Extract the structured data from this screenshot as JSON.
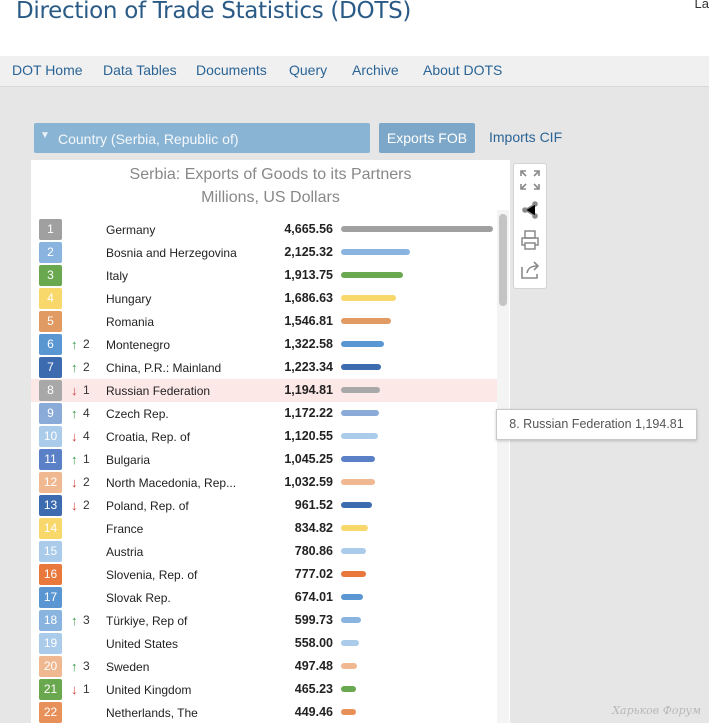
{
  "header": {
    "title": "Direction of Trade Statistics (DOTS)",
    "corner_text": "La"
  },
  "nav": {
    "items": [
      {
        "label": "DOT Home"
      },
      {
        "label": "Data Tables"
      },
      {
        "label": "Documents"
      },
      {
        "label": "Query"
      },
      {
        "label": "Archive"
      },
      {
        "label": "About DOTS"
      }
    ]
  },
  "controls": {
    "country_select": "Country  (Serbia, Republic of)",
    "exports_label": "Exports FOB",
    "imports_label": "Imports CIF"
  },
  "tooltip": {
    "text": "8. Russian Federation 1,194.81"
  },
  "watermark": "Харьков Форум",
  "colors": {
    "highlight_row": "#fde8e8",
    "up_arrow": "#3a9a4a",
    "down_arrow": "#d23c3c",
    "tab_active": "#7ca7c8"
  },
  "chart_data": {
    "type": "bar",
    "orientation": "horizontal",
    "title": "Serbia: Exports of Goods to its Partners",
    "subtitle": "Millions, US Dollars",
    "highlighted_rank": 8,
    "max_value": 4665.56,
    "rows": [
      {
        "rank": "1",
        "dir": "",
        "chg": "",
        "name": "Germany",
        "value": 4665.56,
        "value_label": "4,665.56",
        "color": "#a0a0a0"
      },
      {
        "rank": "2",
        "dir": "",
        "chg": "",
        "name": "Bosnia and Herzegovina",
        "value": 2125.32,
        "value_label": "2,125.32",
        "color": "#8ab4e0"
      },
      {
        "rank": "3",
        "dir": "",
        "chg": "",
        "name": "Italy",
        "value": 1913.75,
        "value_label": "1,913.75",
        "color": "#6aa84f"
      },
      {
        "rank": "4",
        "dir": "",
        "chg": "",
        "name": "Hungary",
        "value": 1686.63,
        "value_label": "1,686.63",
        "color": "#f8d86a"
      },
      {
        "rank": "5",
        "dir": "",
        "chg": "",
        "name": "Romania",
        "value": 1546.81,
        "value_label": "1,546.81",
        "color": "#e09a62"
      },
      {
        "rank": "6",
        "dir": "up",
        "chg": "2",
        "name": "Montenegro",
        "value": 1322.58,
        "value_label": "1,322.58",
        "color": "#5a96d2"
      },
      {
        "rank": "7",
        "dir": "up",
        "chg": "2",
        "name": "China, P.R.: Mainland",
        "value": 1223.34,
        "value_label": "1,223.34",
        "color": "#3d6bb0"
      },
      {
        "rank": "8",
        "dir": "down",
        "chg": "1",
        "name": "Russian Federation",
        "value": 1194.81,
        "value_label": "1,194.81",
        "color": "#a8a8a8"
      },
      {
        "rank": "9",
        "dir": "up",
        "chg": "4",
        "name": "Czech Rep.",
        "value": 1172.22,
        "value_label": "1,172.22",
        "color": "#8aaad8"
      },
      {
        "rank": "10",
        "dir": "down",
        "chg": "4",
        "name": "Croatia, Rep. of",
        "value": 1120.55,
        "value_label": "1,120.55",
        "color": "#aacbea"
      },
      {
        "rank": "11",
        "dir": "up",
        "chg": "1",
        "name": "Bulgaria",
        "value": 1045.25,
        "value_label": "1,045.25",
        "color": "#5a80c8"
      },
      {
        "rank": "12",
        "dir": "down",
        "chg": "2",
        "name": "North Macedonia, Rep...",
        "value": 1032.59,
        "value_label": "1,032.59",
        "color": "#f0b890"
      },
      {
        "rank": "13",
        "dir": "down",
        "chg": "2",
        "name": "Poland, Rep. of",
        "value": 961.52,
        "value_label": "961.52",
        "color": "#3d6bb0"
      },
      {
        "rank": "14",
        "dir": "",
        "chg": "",
        "name": "France",
        "value": 834.82,
        "value_label": "834.82",
        "color": "#f8d86a"
      },
      {
        "rank": "15",
        "dir": "",
        "chg": "",
        "name": "Austria",
        "value": 780.86,
        "value_label": "780.86",
        "color": "#aacbea"
      },
      {
        "rank": "16",
        "dir": "",
        "chg": "",
        "name": "Slovenia, Rep. of",
        "value": 777.02,
        "value_label": "777.02",
        "color": "#e8783c"
      },
      {
        "rank": "17",
        "dir": "",
        "chg": "",
        "name": "Slovak Rep.",
        "value": 674.01,
        "value_label": "674.01",
        "color": "#5a96d2"
      },
      {
        "rank": "18",
        "dir": "up",
        "chg": "3",
        "name": "Türkiye, Rep of",
        "value": 599.73,
        "value_label": "599.73",
        "color": "#8ab4e0"
      },
      {
        "rank": "19",
        "dir": "",
        "chg": "",
        "name": "United States",
        "value": 558.0,
        "value_label": "558.00",
        "color": "#aacbea"
      },
      {
        "rank": "20",
        "dir": "up",
        "chg": "3",
        "name": "Sweden",
        "value": 497.48,
        "value_label": "497.48",
        "color": "#f0b890"
      },
      {
        "rank": "21",
        "dir": "down",
        "chg": "1",
        "name": "United Kingdom",
        "value": 465.23,
        "value_label": "465.23",
        "color": "#6aa84f"
      },
      {
        "rank": "22",
        "dir": "",
        "chg": "",
        "name": "Netherlands, The",
        "value": 449.46,
        "value_label": "449.46",
        "color": "#e8905a"
      }
    ]
  }
}
